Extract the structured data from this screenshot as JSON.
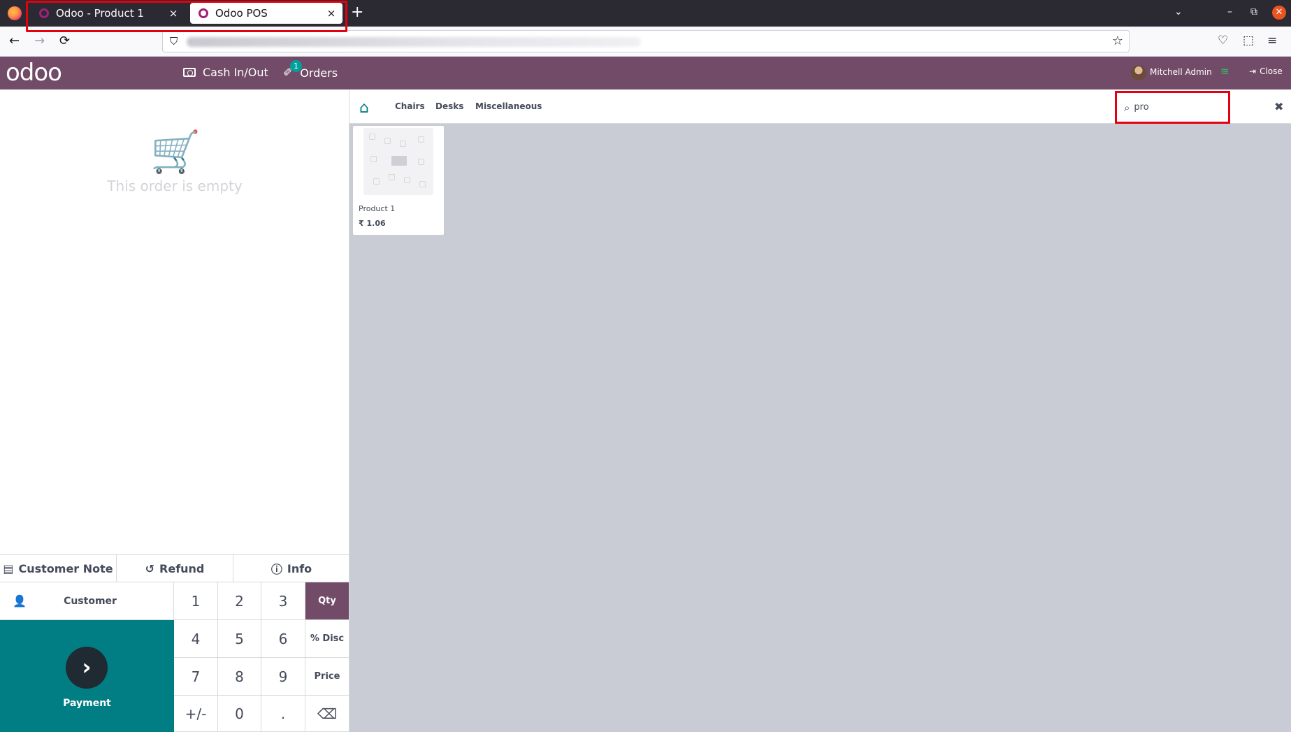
{
  "browser": {
    "tabs": [
      {
        "label": "Odoo - Product 1",
        "close": "×"
      },
      {
        "label": "Odoo POS",
        "close": "×"
      }
    ],
    "new_tab": "+",
    "tabs_list": "⌄",
    "minimize": "–",
    "restore": "⧉",
    "close_window": "✕",
    "nav": {
      "back": "←",
      "forward": "→",
      "reload": "⟳"
    },
    "url_icons": {
      "shield": "⛉",
      "star": "☆"
    },
    "toolbar": {
      "pocket": "♡",
      "extensions": "⬚",
      "menu": "≡"
    }
  },
  "pos_header": {
    "logo": "odoo",
    "cash_label": "Cash In/Out",
    "orders_label": "Orders",
    "orders_badge": "1",
    "user_name": "Mitchell Admin",
    "wifi": "≋",
    "close_label": "Close",
    "close_icon": "⇥"
  },
  "order": {
    "empty_icon": "🛒",
    "empty_text": "This order is empty"
  },
  "controls": {
    "customer_note": "Customer Note",
    "customer_note_icon": "▤",
    "refund": "Refund",
    "refund_icon": "↺",
    "info": "Info",
    "info_icon": "ⓘ"
  },
  "actionpad": {
    "customer_label": "Customer",
    "customer_icon": "👤",
    "payment_label": "Payment",
    "payment_icon": "›"
  },
  "numpad": {
    "keys": [
      "1",
      "2",
      "3",
      "4",
      "5",
      "6",
      "7",
      "8",
      "9",
      "+/-",
      "0",
      "."
    ],
    "modes": [
      "Qty",
      "% Disc",
      "Price"
    ],
    "backspace": "⌫"
  },
  "categories": {
    "home_icon": "⌂",
    "items": [
      "Chairs",
      "Desks",
      "Miscellaneous"
    ]
  },
  "search": {
    "icon": "⌕",
    "value": "pro",
    "clear": "✖"
  },
  "products": [
    {
      "name": "Product 1",
      "price": "₹ 1.06"
    }
  ],
  "colors": {
    "brand": "#714b67",
    "payment": "#017e84",
    "highlight": "#e3000f"
  }
}
